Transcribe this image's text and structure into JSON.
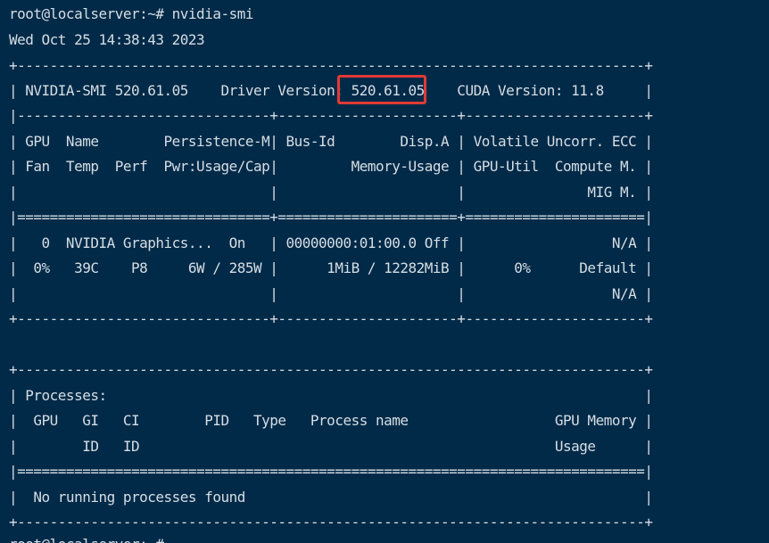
{
  "terminal": {
    "prompt": "root@localserver:~# nvidia-smi",
    "timestamp": "Wed Oct 25 14:38:43 2023",
    "highlight_color": "#e03a36",
    "background": "#012a48",
    "foreground": "#d6dde4",
    "lines": [
      "+-----------------------------------------------------------------------------+",
      "| NVIDIA-SMI 520.61.05    Driver Version: 520.61.05    CUDA Version: 11.8     |",
      "|-------------------------------+----------------------+----------------------+",
      "| GPU  Name        Persistence-M| Bus-Id        Disp.A | Volatile Uncorr. ECC |",
      "| Fan  Temp  Perf  Pwr:Usage/Cap|         Memory-Usage | GPU-Util  Compute M. |",
      "|                               |                      |               MIG M. |",
      "|===============================+======================+======================|",
      "|   0  NVIDIA Graphics...  On   | 00000000:01:00.0 Off |                  N/A |",
      "|  0%   39C    P8     6W / 285W |      1MiB / 12282MiB |      0%      Default |",
      "|                               |                      |                  N/A |",
      "+-------------------------------+----------------------+----------------------+",
      "",
      "+-----------------------------------------------------------------------------+",
      "| Processes:                                                                  |",
      "|  GPU   GI   CI        PID   Type   Process name                  GPU Memory |",
      "|        ID   ID                                                   Usage      |",
      "|=============================================================================|",
      "|  No running processes found                                                 |",
      "+-----------------------------------------------------------------------------+"
    ],
    "next_prompt": "root@localserver:~#"
  }
}
